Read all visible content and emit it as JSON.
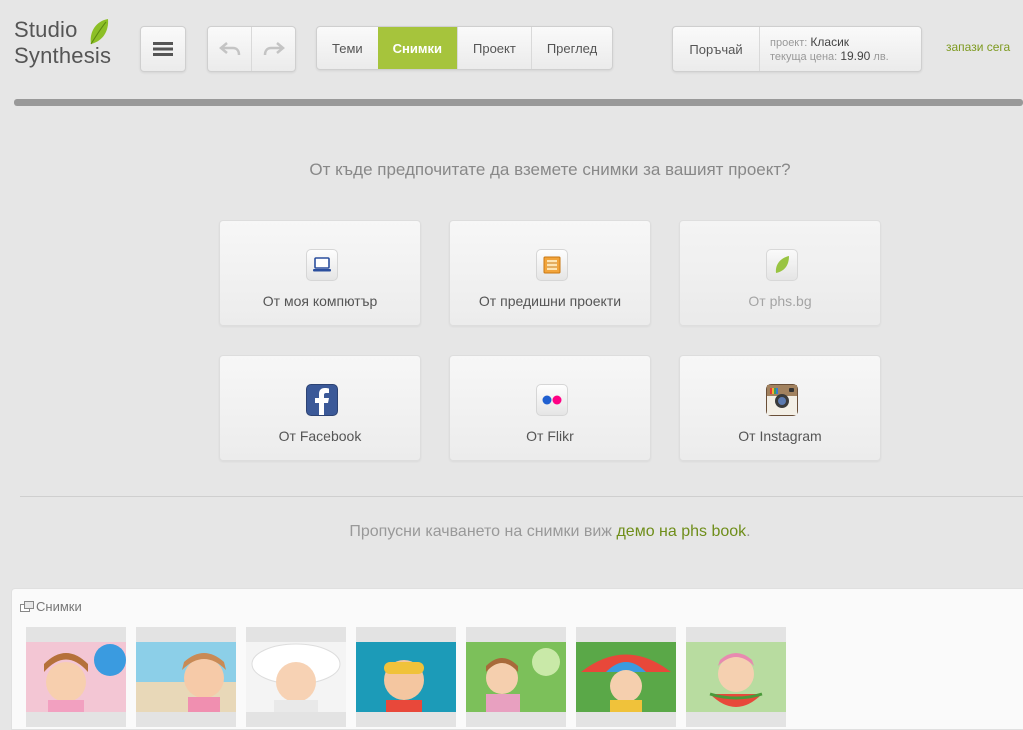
{
  "brand": {
    "line1": "Studio",
    "line2": "Synthesis"
  },
  "header": {
    "tabs": [
      {
        "label": "Теми",
        "active": false
      },
      {
        "label": "Снимки",
        "active": true
      },
      {
        "label": "Проект",
        "active": false
      },
      {
        "label": "Преглед",
        "active": false
      }
    ],
    "order_button": "Поръчай",
    "project_label": "проект:",
    "project_value": "Класик",
    "price_label": "текуща цена:",
    "price_value": "19.90",
    "price_unit": "лв.",
    "save_now": "запази сега"
  },
  "main": {
    "question": "От къде предпочитате да вземете снимки за вашият проект?",
    "sources": [
      {
        "label": "От моя компютър",
        "icon": "laptop-icon"
      },
      {
        "label": "От предишни проекти",
        "icon": "film-icon"
      },
      {
        "label": "От phs.bg",
        "icon": "leaf-icon"
      },
      {
        "label": "От Facebook",
        "icon": "facebook-icon"
      },
      {
        "label": "От Flikr",
        "icon": "flickr-icon"
      },
      {
        "label": "От Instagram",
        "icon": "instagram-icon"
      }
    ],
    "skip_text": "Пропусни качването на снимки виж",
    "skip_link": "демо на phs book",
    "skip_end": "."
  },
  "photos": {
    "title": "Снимки",
    "count": 7
  },
  "colors": {
    "accent": "#a6c43c",
    "link": "#6f8e1a"
  }
}
